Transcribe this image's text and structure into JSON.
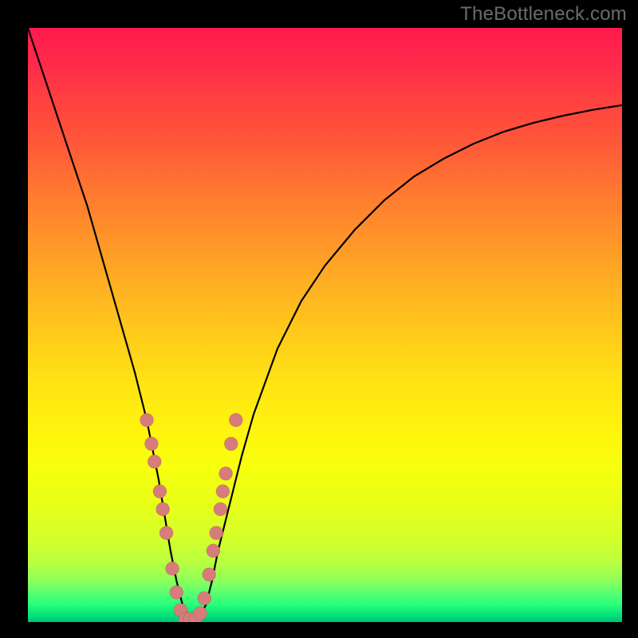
{
  "watermark": "TheBottleneck.com",
  "chart_data": {
    "type": "line",
    "title": "",
    "xlabel": "",
    "ylabel": "",
    "xlim": [
      0,
      100
    ],
    "ylim": [
      0,
      100
    ],
    "grid": false,
    "legend": false,
    "series": [
      {
        "name": "bottleneck-curve",
        "x": [
          0,
          2,
          4,
          6,
          8,
          10,
          12,
          14,
          16,
          18,
          20,
          22,
          23,
          24,
          25,
          26,
          27,
          27.7,
          29,
          30,
          31,
          32,
          34,
          36,
          38,
          42,
          46,
          50,
          55,
          60,
          65,
          70,
          75,
          80,
          85,
          90,
          95,
          100
        ],
        "y": [
          100,
          94,
          88,
          82,
          76,
          70,
          63,
          56,
          49,
          42,
          34,
          24,
          18,
          12,
          7,
          3,
          1,
          0,
          1,
          3,
          7,
          12,
          20,
          28,
          35,
          46,
          54,
          60,
          66,
          71,
          75,
          78,
          80.5,
          82.5,
          84,
          85.2,
          86.2,
          87
        ]
      }
    ],
    "markers": {
      "name": "highlighted-points",
      "x": [
        20.0,
        20.8,
        21.3,
        22.2,
        22.7,
        23.3,
        24.3,
        25.0,
        25.7,
        26.5,
        27.2,
        28.2,
        29.0,
        29.7,
        30.5,
        31.2,
        31.7,
        32.4,
        32.8,
        33.3,
        34.2,
        35.0
      ],
      "y": [
        34.0,
        30.0,
        27.0,
        22.0,
        19.0,
        15.0,
        9.0,
        5.0,
        2.0,
        0.5,
        0.5,
        0.5,
        1.5,
        4.0,
        8.0,
        12.0,
        15.0,
        19.0,
        22.0,
        25.0,
        30.0,
        34.0
      ]
    }
  }
}
